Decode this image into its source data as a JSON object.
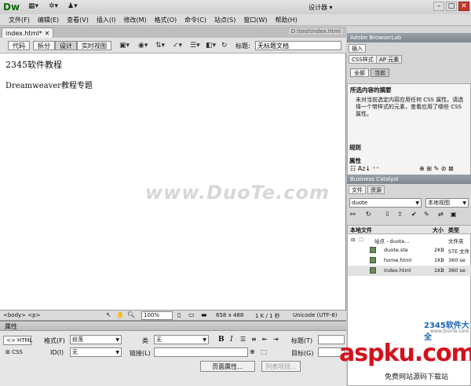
{
  "app": {
    "logo": "Dw",
    "toolbar_icons": [
      "layout-icon",
      "gear-icon",
      "person-icon"
    ],
    "workspace": "设计器"
  },
  "menu": [
    "文件(F)",
    "编辑(E)",
    "查看(V)",
    "插入(I)",
    "修改(M)",
    "格式(O)",
    "命令(C)",
    "站点(S)",
    "窗口(W)",
    "帮助(H)"
  ],
  "doc_tab": {
    "name": "index.html*",
    "path": "D:\\test\\index.html"
  },
  "views": {
    "code": "代码",
    "split": "拆分",
    "design": "设计",
    "live": "实时视图"
  },
  "title_field": {
    "label": "标题:",
    "value": "无标题文档"
  },
  "page": {
    "heading": "2345软件教程",
    "paragraph": "Dreamweaver教程专题",
    "watermark": "www.DuoTe.com"
  },
  "status": {
    "tag": "<body> <p>",
    "zoom": "100%",
    "dimensions": "658 x 488",
    "stats": "1 K / 1 秒",
    "encoding": "Unicode (UTF-8)"
  },
  "properties": {
    "title": "属性",
    "html_btn": "HTML",
    "css_btn": "CSS",
    "format_label": "格式(F)",
    "format_value": "段落",
    "class_label": "类",
    "class_value": "无",
    "id_label": "ID(I)",
    "id_value": "无",
    "link_label": "链接(L)",
    "bold": "B",
    "italic": "I",
    "title_label": "标题(T)",
    "target_label": "目标(G)",
    "page_props_btn": "页面属性...",
    "list_item_btn": "列表项目..."
  },
  "right_panel": {
    "browserlab": "Adobe BrowserLab",
    "insert_tab": "插入",
    "css_tab": "CSS样式",
    "ap_tab": "AP 元素",
    "all_btn": "全部",
    "current_btn": "当前",
    "summary_title": "所选内容的摘要",
    "summary_text": "未对当前选定内容应用任何 CSS 属性。请选择一个带样式的元素，查看应用了哪些 CSS 属性。",
    "rules_label": "规则",
    "props_label": "属性",
    "bc": "Business Catalyst",
    "files_tab": "文件",
    "assets_tab": "资源",
    "site_select": "duote",
    "view_select": "本地视图",
    "files_header": {
      "name": "本地文件",
      "size": "大小",
      "type": "类型"
    },
    "files": [
      {
        "name": "站点 - duote...",
        "size": "",
        "type": "文件夹"
      },
      {
        "name": "duote.ste",
        "size": "2KB",
        "type": "STE 文件"
      },
      {
        "name": "home.html",
        "size": "1KB",
        "type": "360 se"
      },
      {
        "name": "index.html",
        "size": "1KB",
        "type": "360 se"
      }
    ]
  },
  "watermarks": {
    "brand": "2345软件大全",
    "brand_url": "www.DuoTe.com",
    "asp": "aspku.com",
    "asp_sub": "免费网站源码下载站"
  }
}
